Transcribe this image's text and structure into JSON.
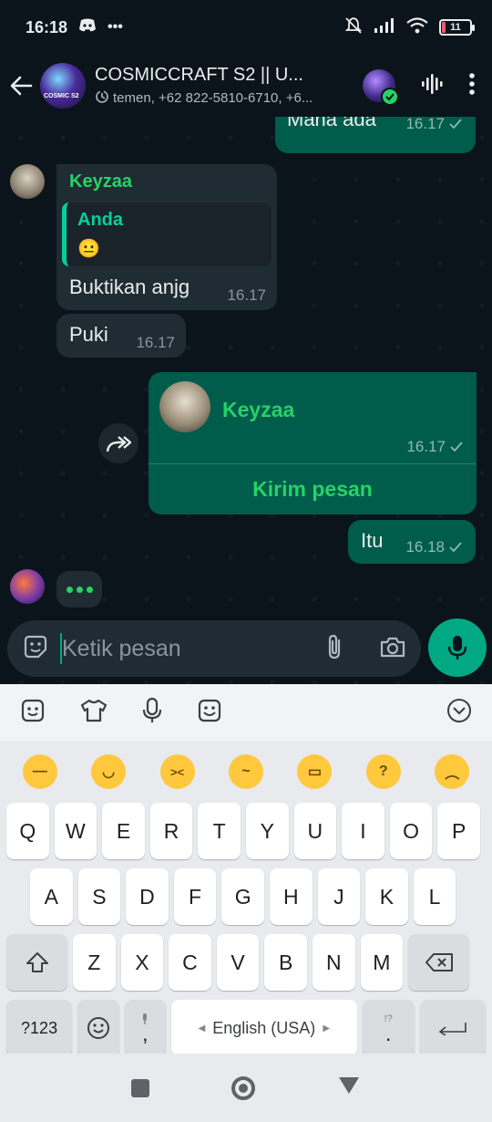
{
  "status": {
    "time": "16:18",
    "battery": "11"
  },
  "header": {
    "title": "COSMICCRAFT S2 || U...",
    "subtitle": "temen, +62 822-5810-6710, +6..."
  },
  "messages": {
    "m1": {
      "text": "Mana ada",
      "time": "16.17"
    },
    "m2": {
      "sender": "Keyzaa",
      "quote_author": "Anda",
      "quote_text": "😐",
      "text": "Buktikan anjg",
      "time": "16.17"
    },
    "m3": {
      "text": "Puki",
      "time": "16.17"
    },
    "m4": {
      "contact_name": "Keyzaa",
      "time": "16.17",
      "action": "Kirim pesan"
    },
    "m5": {
      "text": "Itu",
      "time": "16.18"
    }
  },
  "input": {
    "placeholder": "Ketik pesan"
  },
  "keyboard": {
    "row1": [
      "Q",
      "W",
      "E",
      "R",
      "T",
      "Y",
      "U",
      "I",
      "O",
      "P"
    ],
    "row2": [
      "A",
      "S",
      "D",
      "F",
      "G",
      "H",
      "J",
      "K",
      "L"
    ],
    "row3": [
      "Z",
      "X",
      "C",
      "V",
      "B",
      "N",
      "M"
    ],
    "sym_key": "?123",
    "comma": ",",
    "space_label": "English (USA)",
    "period": ".",
    "period_hint": "!?"
  },
  "colors": {
    "accent": "#00a884",
    "outgoing": "#005c4b",
    "incoming": "#202c33",
    "sender": "#53bdeb"
  }
}
